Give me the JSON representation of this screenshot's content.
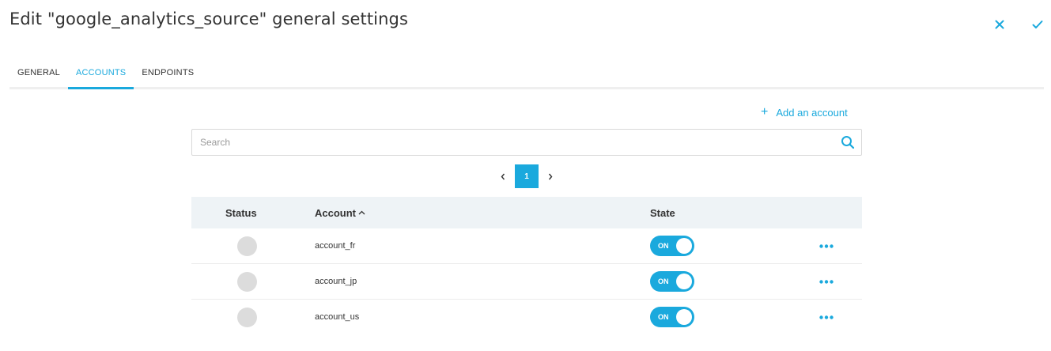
{
  "header": {
    "title": "Edit \"google_analytics_source\" general settings",
    "close_icon": "close-icon",
    "confirm_icon": "check-icon"
  },
  "tabs": [
    {
      "label": "GENERAL",
      "active": false
    },
    {
      "label": "ACCOUNTS",
      "active": true
    },
    {
      "label": "ENDPOINTS",
      "active": false
    }
  ],
  "accounts_panel": {
    "add_account_label": "Add an account",
    "search": {
      "placeholder": "Search",
      "value": ""
    },
    "pagination": {
      "current_page": "1"
    },
    "table": {
      "columns": {
        "status": "Status",
        "account": "Account",
        "state": "State"
      },
      "sorted_by": "Account",
      "sort_direction": "ascending",
      "rows": [
        {
          "account": "account_fr",
          "state": "ON"
        },
        {
          "account": "account_jp",
          "state": "ON"
        },
        {
          "account": "account_us",
          "state": "ON"
        }
      ]
    }
  },
  "colors": {
    "accent": "#1aa9dd",
    "header_bg": "#eef3f6",
    "status_dot": "#dcdcdc"
  }
}
